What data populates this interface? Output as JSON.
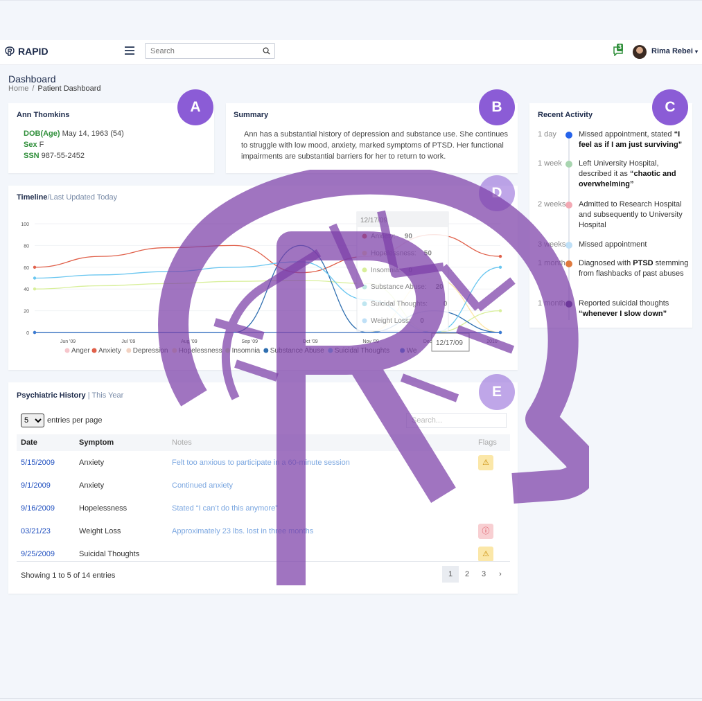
{
  "app": {
    "brand": "RAPID",
    "search_placeholder": "Search",
    "notifications_count": "3",
    "user_name": "Rima Rebei"
  },
  "page": {
    "title": "Dashboard",
    "breadcrumb": [
      "Home",
      "Patient Dashboard"
    ]
  },
  "markers": [
    "A",
    "B",
    "C",
    "D",
    "E"
  ],
  "patient": {
    "name": "Ann Thomkins",
    "dob_label": "DOB(Age)",
    "dob_value": "May 14, 1963 (54)",
    "sex_label": "Sex",
    "sex_value": "F",
    "ssn_label": "SSN",
    "ssn_value": "987-55-2452"
  },
  "summary": {
    "title": "Summary",
    "text": "Ann has a substantial history of depression and substance use. She continues to struggle with low mood, anxiety, marked symptoms of PTSD. Her functional impairments are substantial barriers for her to return to work."
  },
  "activity": {
    "title": "Recent Activity",
    "items": [
      {
        "when": "1 day",
        "text": "Missed appointment, stated ",
        "bold": "“I feel as if I am just surviving”",
        "color": "#2563eb"
      },
      {
        "when": "1 week",
        "text": "Left University Hospital, described it as ",
        "bold": "“chaotic and overwhelming”",
        "color": "#a8d5b0"
      },
      {
        "when": "2 weeks",
        "text": "Admitted to Research Hospital and subsequently to University Hospital",
        "bold": "",
        "color": "#f3a9b4"
      },
      {
        "when": "3 weeks",
        "text": "Missed appointment",
        "bold": "",
        "color": "#bfe0f7"
      },
      {
        "when": "1 month",
        "text": "Diagnosed with ",
        "bold": "PTSD",
        "text2": " stemming from flashbacks of past abuses",
        "color": "#e07a3e"
      },
      {
        "when": "1 month",
        "text": "Reported suicidal thoughts ",
        "bold": "“whenever I slow down”",
        "color": "#4b2a7a"
      }
    ]
  },
  "timeline": {
    "title": "Timeline",
    "subtitle": "Last Updated Today"
  },
  "chart_data": {
    "type": "line",
    "x": [
      "Jun '09",
      "Jul '09",
      "Aug '09",
      "Sep '09",
      "Oct '09",
      "Nov '09",
      "Dec '09",
      "2010"
    ],
    "ylim": [
      0,
      100
    ],
    "yticks": [
      0,
      20,
      40,
      60,
      80,
      100
    ],
    "series": [
      {
        "name": "Anger",
        "color": "#f6c6cc",
        "values": [
          0,
          0,
          0,
          0,
          0,
          0,
          0,
          0
        ]
      },
      {
        "name": "Anxiety",
        "color": "#e0604a",
        "values": [
          60,
          70,
          78,
          80,
          55,
          70,
          90,
          70
        ]
      },
      {
        "name": "Depression",
        "color": "#f2d2c2",
        "values": [
          0,
          0,
          0,
          0,
          0,
          0,
          0,
          0
        ]
      },
      {
        "name": "Hopelessness",
        "color": "#fde6a8",
        "values": [
          0,
          0,
          0,
          0,
          0,
          0,
          50,
          0
        ]
      },
      {
        "name": "Insomnia",
        "color": "#d8ef9a",
        "values": [
          40,
          43,
          45,
          47,
          48,
          45,
          0,
          20
        ]
      },
      {
        "name": "Substance Abuse",
        "color": "#2f6fb0",
        "values": [
          0,
          0,
          0,
          0,
          80,
          0,
          20,
          0
        ]
      },
      {
        "name": "Suicidal Thoughts",
        "color": "#69c6f0",
        "values": [
          50,
          53,
          56,
          60,
          65,
          30,
          0,
          60
        ]
      },
      {
        "name": "Weight Loss",
        "color": "#3a7bd5",
        "values": [
          0,
          0,
          0,
          0,
          0,
          0,
          0,
          0
        ]
      }
    ],
    "tooltip": {
      "date": "12/17/09",
      "rows": [
        {
          "label": "Anxiety:",
          "value": "90"
        },
        {
          "label": "Hopelessness:",
          "value": "50"
        },
        {
          "label": "Insomnia:",
          "value": "0"
        },
        {
          "label": "Substance Abuse:",
          "value": "20"
        },
        {
          "label": "Suicidal Thoughts:",
          "value": "0"
        },
        {
          "label": "Weight Loss:",
          "value": "0"
        }
      ],
      "xlabel": "12/17/09"
    },
    "legend_labels": [
      "Anger",
      "Anxiety",
      "Depression",
      "Hopelessness",
      "Insomnia",
      "Substance Abuse",
      "Suicidal Thoughts",
      "We"
    ]
  },
  "history": {
    "title": "Psychiatric History",
    "subtitle": "This Year",
    "page_size": "5",
    "entries_label": "entries per page",
    "search_placeholder": "Search...",
    "columns": [
      "Date",
      "Symptom",
      "Notes",
      "Flags"
    ],
    "rows": [
      {
        "date": "5/15/2009",
        "symptom": "Anxiety",
        "notes": "Felt too anxious to participate in a 60-minute session",
        "flag": "warn"
      },
      {
        "date": "9/1/2009",
        "symptom": "Anxiety",
        "notes": "Continued anxiety",
        "flag": ""
      },
      {
        "date": "9/16/2009",
        "symptom": "Hopelessness",
        "notes": "Stated “I can’t do this anymore”",
        "flag": ""
      },
      {
        "date": "03/21/23",
        "symptom": "Weight Loss",
        "notes": "Approximately 23 lbs. lost in three months",
        "flag": "crit"
      },
      {
        "date": "9/25/2009",
        "symptom": "Suicidal Thoughts",
        "notes": "",
        "flag": "warn"
      }
    ],
    "footer": "Showing 1 to 5 of 14 entries",
    "pages": [
      "1",
      "2",
      "3",
      "›"
    ]
  }
}
